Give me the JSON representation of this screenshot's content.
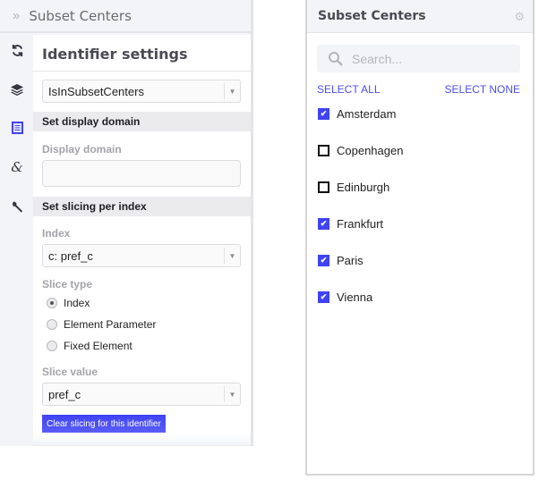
{
  "left_panel": {
    "header_title": "Subset Centers",
    "collapse_glyph": "»",
    "icon_bar": [
      "refresh-icon",
      "layers-icon",
      "document-icon",
      "ampersand-icon",
      "wrench-icon"
    ],
    "heading": "Identifier settings",
    "identifier_select": "IsInSubsetCenters",
    "section_display_domain": "Set display domain",
    "display_domain_label": "Display domain",
    "display_domain_value": "",
    "section_slicing": "Set slicing per index",
    "index_label": "Index",
    "index_select": "c: pref_c",
    "slice_type_label": "Slice type",
    "slice_types": [
      {
        "label": "Index",
        "selected": true
      },
      {
        "label": "Element Parameter",
        "selected": false
      },
      {
        "label": "Fixed Element",
        "selected": false
      }
    ],
    "slice_value_label": "Slice value",
    "slice_value_select": "pref_c",
    "clear_button": "Clear slicing for this identifier"
  },
  "right_panel": {
    "title": "Subset Centers",
    "search_placeholder": "Search...",
    "select_all": "SELECT ALL",
    "select_none": "SELECT NONE",
    "items": [
      {
        "label": "Amsterdam",
        "checked": true
      },
      {
        "label": "Copenhagen",
        "checked": false
      },
      {
        "label": "Edinburgh",
        "checked": false
      },
      {
        "label": "Frankfurt",
        "checked": true
      },
      {
        "label": "Paris",
        "checked": true
      },
      {
        "label": "Vienna",
        "checked": true
      }
    ]
  },
  "colors": {
    "accent": "#3f43f2",
    "link": "#4b4ee8"
  }
}
